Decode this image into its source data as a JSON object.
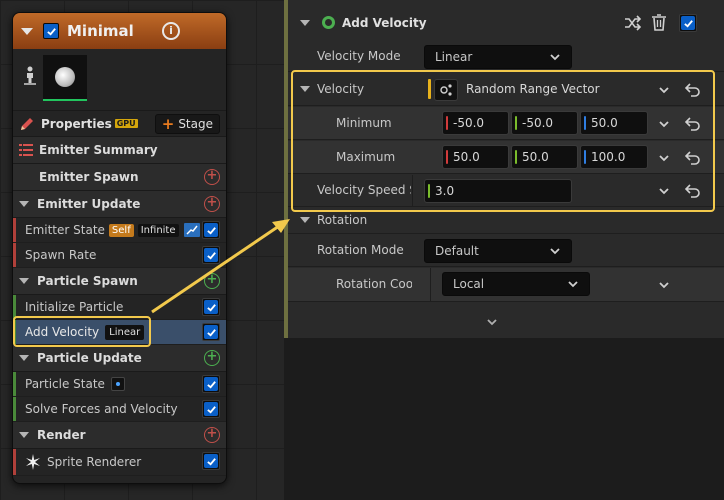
{
  "node": {
    "title": "Minimal",
    "properties_label": "Properties",
    "gpu_badge": "GPU",
    "stage_button": "Stage",
    "sections": {
      "emitter_summary": "Emitter Summary",
      "emitter_spawn": "Emitter Spawn",
      "emitter_update": "Emitter Update",
      "particle_spawn": "Particle Spawn",
      "particle_update": "Particle Update",
      "render": "Render"
    },
    "modules": {
      "emitter_state": "Emitter State",
      "emitter_state_tag_self": "Self",
      "emitter_state_tag_infinite": "Infinite",
      "spawn_rate": "Spawn Rate",
      "initialize_particle": "Initialize Particle",
      "add_velocity": "Add Velocity",
      "add_velocity_tag": "Linear",
      "particle_state": "Particle State",
      "solve_forces": "Solve Forces and Velocity",
      "sprite_renderer": "Sprite Renderer"
    }
  },
  "panel": {
    "title": "Add Velocity",
    "velocity_mode_label": "Velocity Mode",
    "velocity_mode_value": "Linear",
    "velocity_label": "Velocity",
    "velocity_source": "Random Range Vector",
    "minimum_label": "Minimum",
    "minimum": {
      "x": "-50.0",
      "y": "-50.0",
      "z": "50.0"
    },
    "maximum_label": "Maximum",
    "maximum": {
      "x": "50.0",
      "y": "50.0",
      "z": "100.0"
    },
    "velocity_speed_label": "Velocity Speed S",
    "velocity_speed_value": "3.0",
    "rotation_label": "Rotation",
    "rotation_mode_label": "Rotation Mode",
    "rotation_mode_value": "Default",
    "rotation_coord_label": "Rotation Coo",
    "rotation_coord_value": "Local"
  },
  "colors": {
    "header_orange": "#c06a28",
    "highlight_yellow": "#f2c94c",
    "checkbox_blue": "#0a5fc7",
    "selected_row": "#3a4f6a"
  }
}
